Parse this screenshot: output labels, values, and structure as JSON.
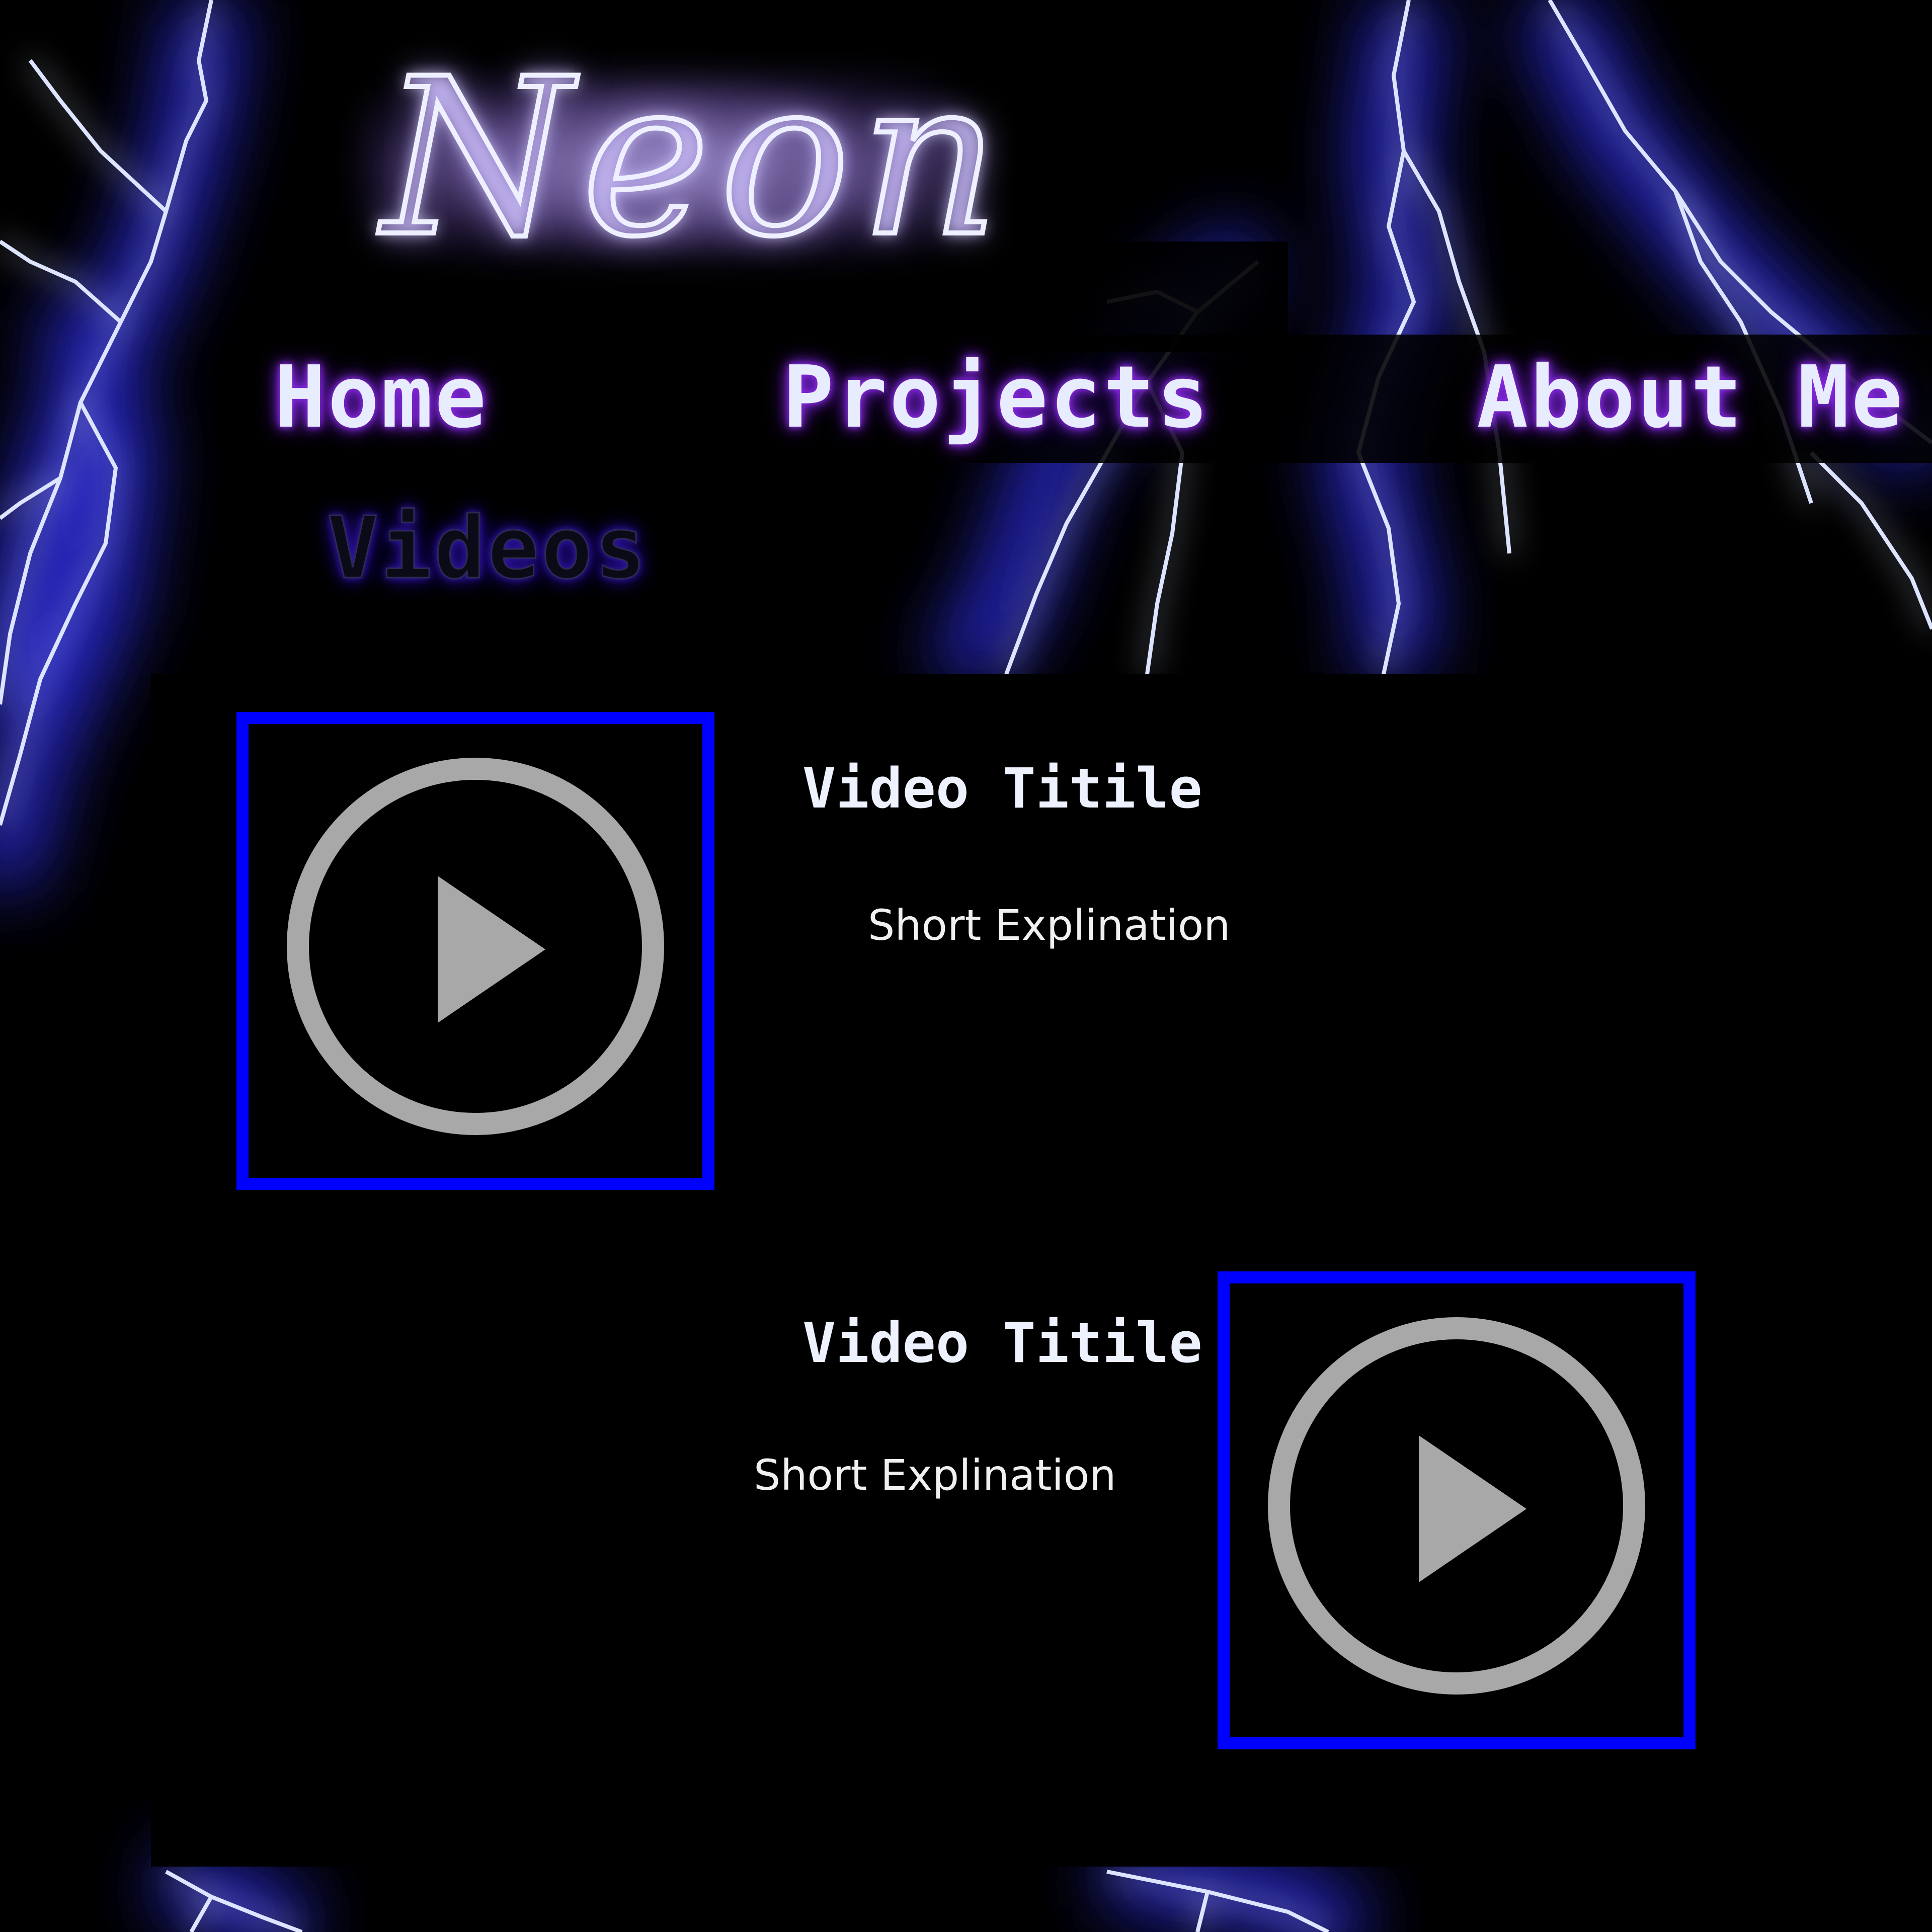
{
  "header": {
    "logo_text": "Neon"
  },
  "nav": {
    "items": [
      {
        "label": "Home"
      },
      {
        "label": "Projects"
      },
      {
        "label": "About Me"
      },
      {
        "label": "Videos"
      }
    ]
  },
  "videos": [
    {
      "title": "Video Titile",
      "description": "Short Explination",
      "icon": "play-circle-icon"
    },
    {
      "title": "Video Titile",
      "description": "Short Explination",
      "icon": "play-circle-icon"
    }
  ],
  "colors": {
    "background": "#000000",
    "lightning": "#3a3aff",
    "thumb_border": "#0000ff",
    "play_icon": "#a8a8a8",
    "nav_glow": "#8a2be2"
  }
}
